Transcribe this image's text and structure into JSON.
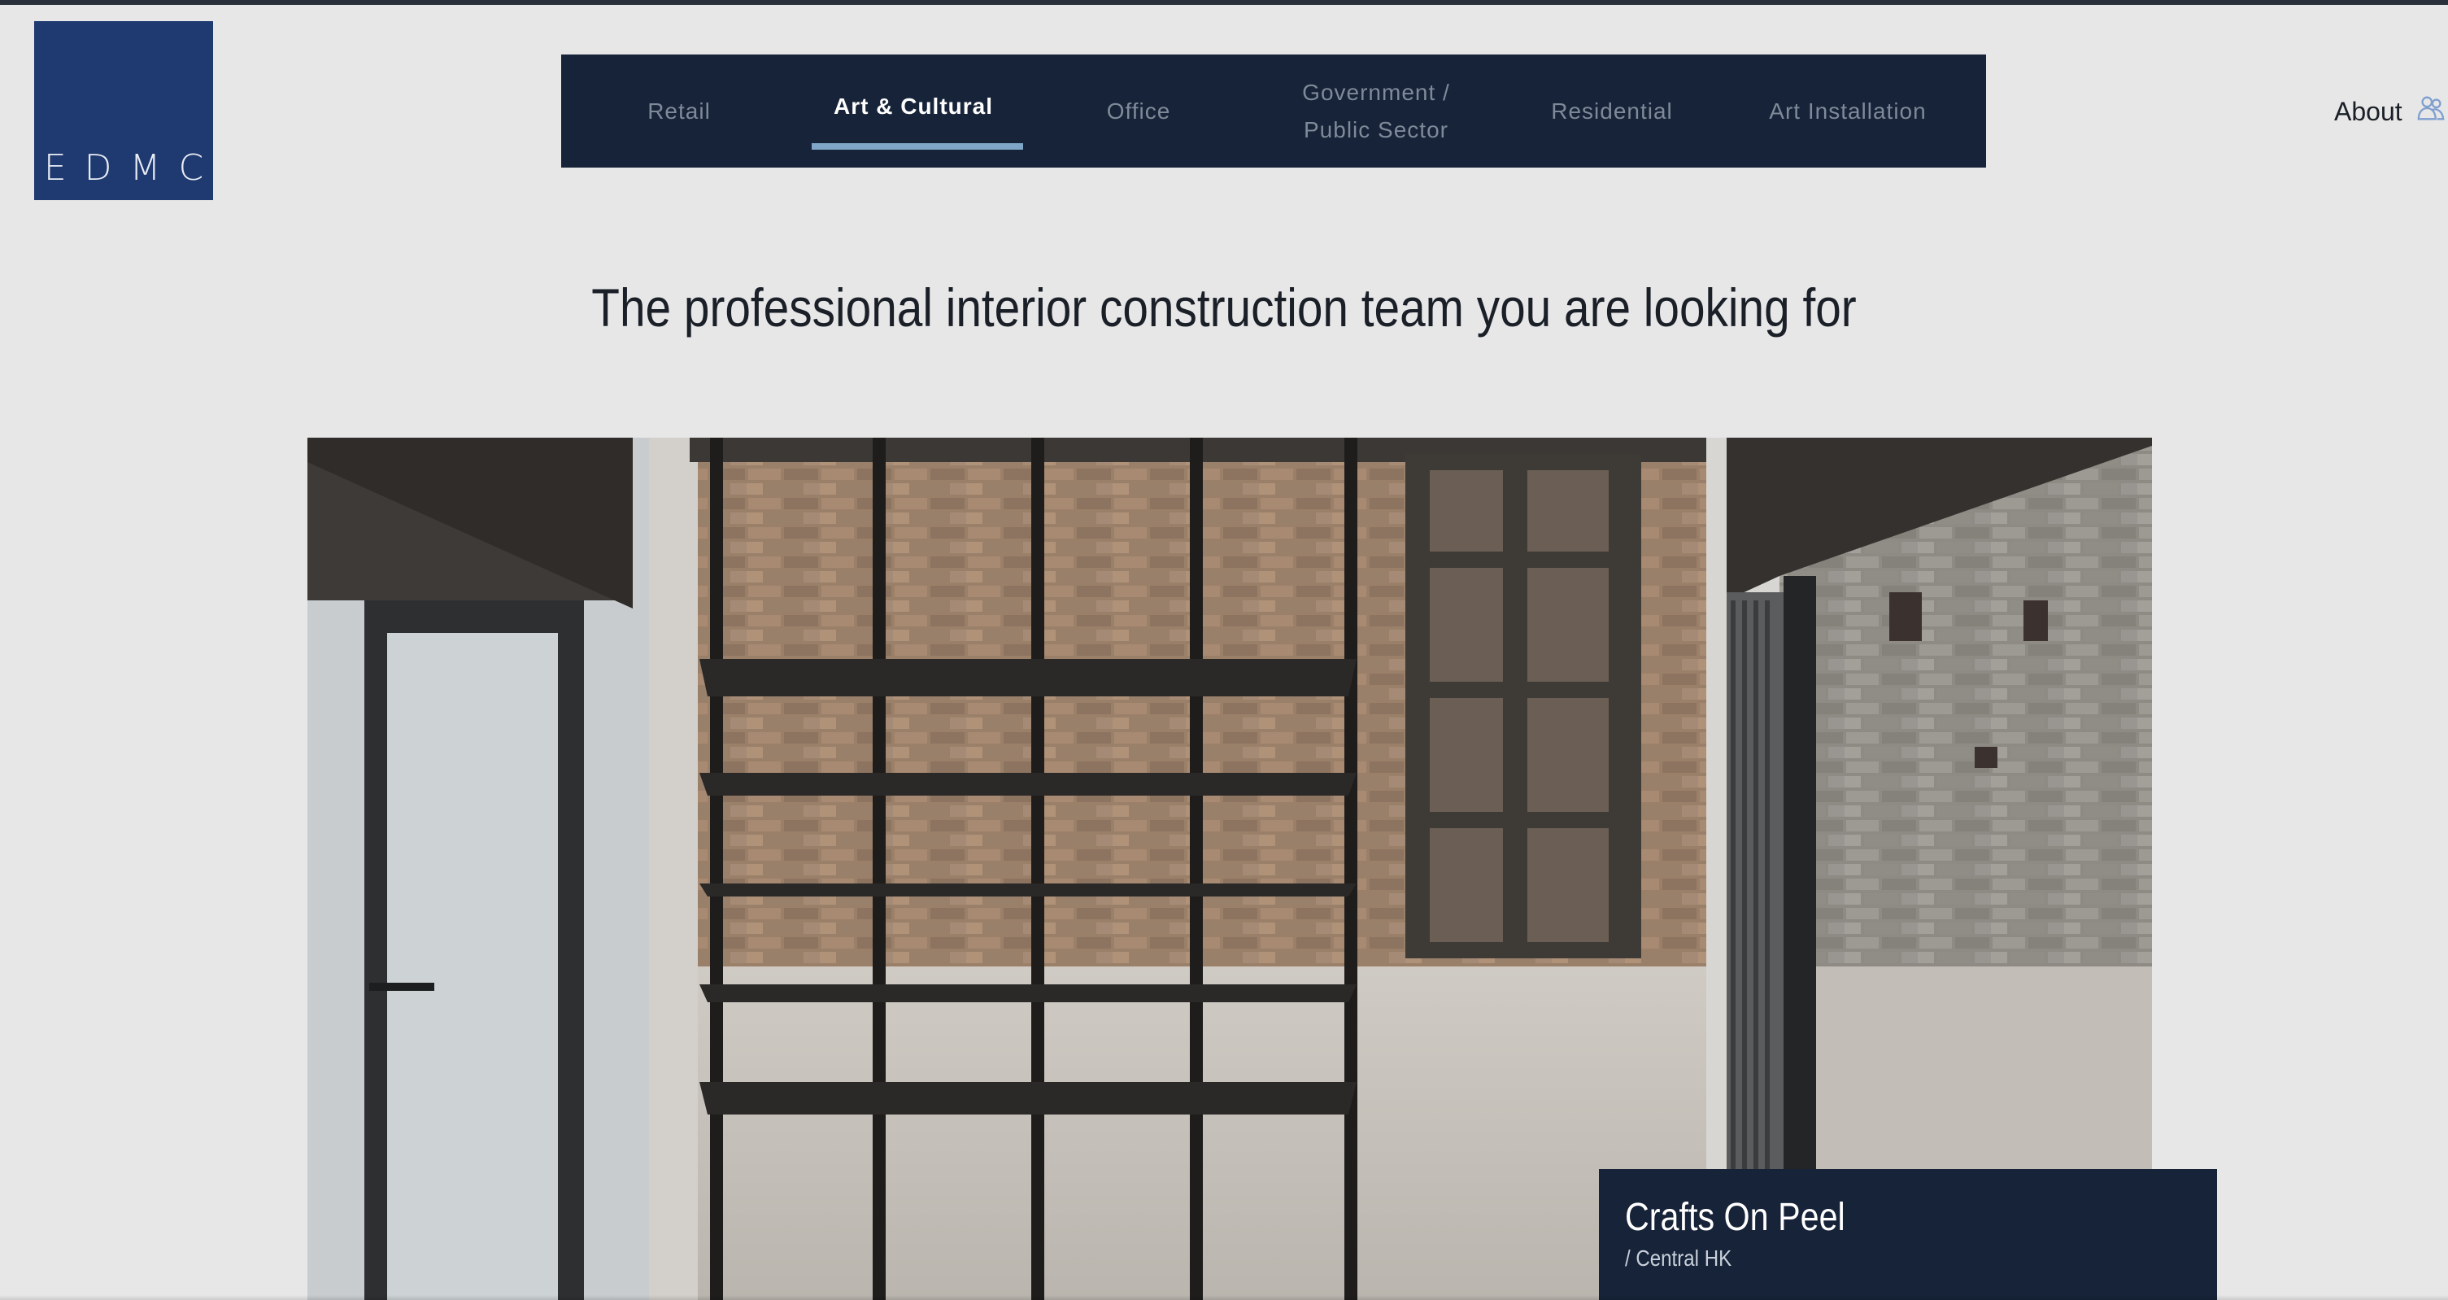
{
  "logo": {
    "text": "EDMC",
    "bg_color": "#1f3a70"
  },
  "nav": {
    "bg_color": "#162338",
    "active_underline_color": "#7fa6c6",
    "items": [
      {
        "label": "Retail",
        "active": false
      },
      {
        "label": "Art & Cultural",
        "active": true
      },
      {
        "label": "Office",
        "active": false
      },
      {
        "label": "Government /\nPublic Sector",
        "active": false
      },
      {
        "label": "Residential",
        "active": false
      },
      {
        "label": "Art Installation",
        "active": false
      }
    ]
  },
  "header": {
    "about_label": "About",
    "about_icon": "people-icon"
  },
  "hero": {
    "headline": "The professional interior construction team you are looking for",
    "project": {
      "title": "Crafts On Peel",
      "location": "/ Central HK"
    }
  }
}
